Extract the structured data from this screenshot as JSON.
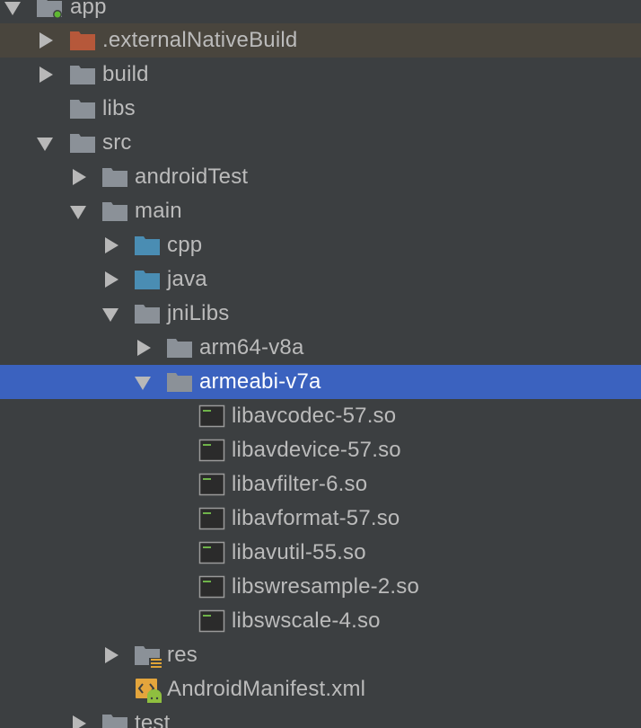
{
  "project_tree": {
    "app": {
      "label": "app",
      "icon": "module-folder-icon",
      "expanded": true
    },
    "external_native_build": {
      "label": ".externalNativeBuild",
      "icon": "excluded-folder-icon",
      "expanded": false
    },
    "build": {
      "label": "build",
      "icon": "folder-icon",
      "expanded": false
    },
    "libs": {
      "label": "libs",
      "icon": "folder-icon"
    },
    "src": {
      "label": "src",
      "icon": "folder-icon",
      "expanded": true
    },
    "android_test": {
      "label": "androidTest",
      "icon": "folder-icon",
      "expanded": false
    },
    "main": {
      "label": "main",
      "icon": "folder-icon",
      "expanded": true
    },
    "cpp": {
      "label": "cpp",
      "icon": "source-folder-icon",
      "expanded": false
    },
    "java": {
      "label": "java",
      "icon": "source-folder-icon",
      "expanded": false
    },
    "jni_libs": {
      "label": "jniLibs",
      "icon": "folder-icon",
      "expanded": true
    },
    "arm64": {
      "label": "arm64-v8a",
      "icon": "folder-icon",
      "expanded": false
    },
    "armeabi": {
      "label": "armeabi-v7a",
      "icon": "folder-icon",
      "expanded": true,
      "selected": true
    },
    "files": [
      {
        "label": "libavcodec-57.so",
        "icon": "binary-file-icon"
      },
      {
        "label": "libavdevice-57.so",
        "icon": "binary-file-icon"
      },
      {
        "label": "libavfilter-6.so",
        "icon": "binary-file-icon"
      },
      {
        "label": "libavformat-57.so",
        "icon": "binary-file-icon"
      },
      {
        "label": "libavutil-55.so",
        "icon": "binary-file-icon"
      },
      {
        "label": "libswresample-2.so",
        "icon": "binary-file-icon"
      },
      {
        "label": "libswscale-4.so",
        "icon": "binary-file-icon"
      }
    ],
    "res": {
      "label": "res",
      "icon": "resource-folder-icon",
      "expanded": false
    },
    "manifest": {
      "label": "AndroidManifest.xml",
      "icon": "android-manifest-icon"
    },
    "test": {
      "label": "test",
      "icon": "folder-icon",
      "expanded": false
    }
  },
  "colors": {
    "background": "#3c3f41",
    "selection": "#3b62bf",
    "excluded_row": "#49453d",
    "folder": "#8b9198",
    "source_folder": "#4a8db3",
    "excluded_folder": "#b6583a",
    "text": "#bbbbbb"
  }
}
